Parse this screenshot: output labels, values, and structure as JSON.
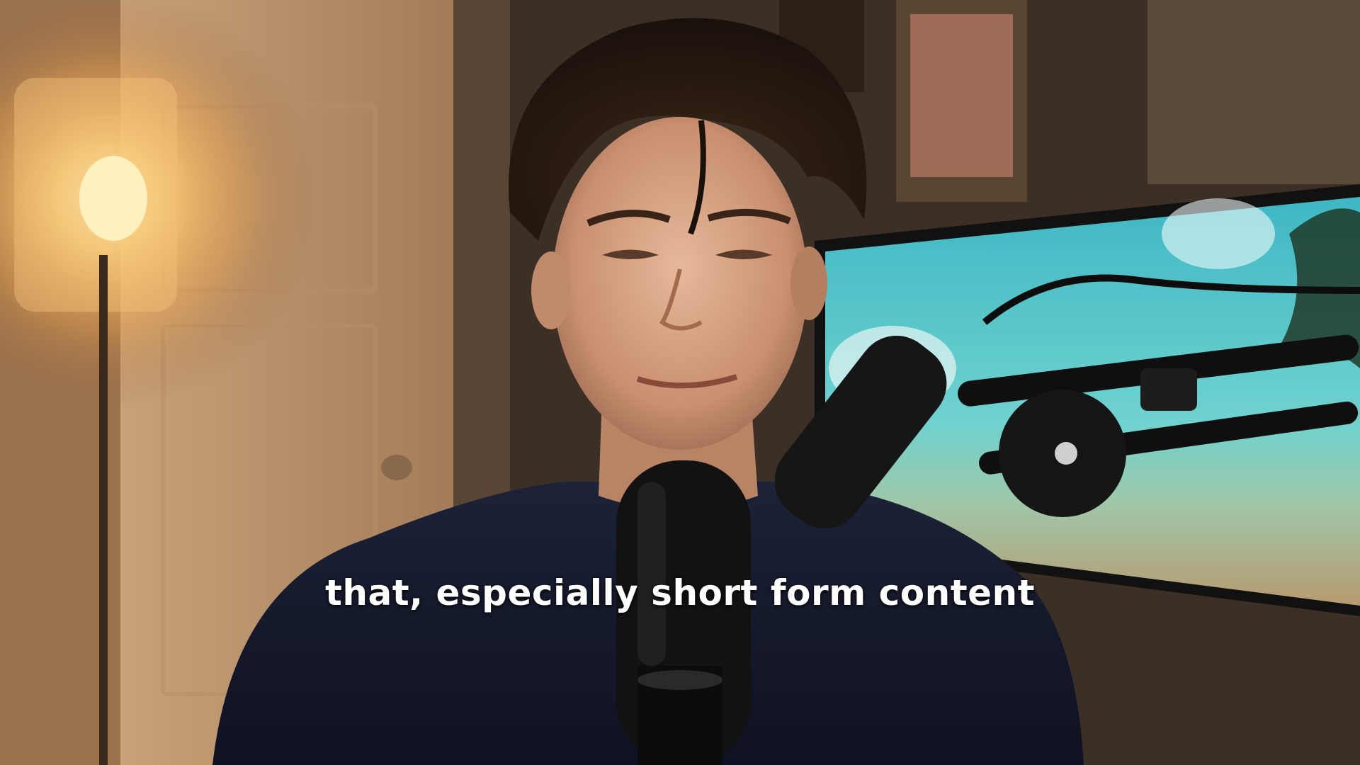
{
  "caption": {
    "text": "that, especially short form content"
  },
  "scene": {
    "description_icons": [
      "floor-lamp",
      "door",
      "framed-picture",
      "monitor",
      "microphone",
      "boom-arm",
      "person"
    ],
    "colors": {
      "lamp_glow": "#ffd27a",
      "wall_warm": "#8a6642",
      "shirt": "#141a2e",
      "hair": "#231812",
      "skin": "#d9a98a",
      "monitor_sky": "#4ec3c9",
      "mic": "#121212"
    }
  }
}
